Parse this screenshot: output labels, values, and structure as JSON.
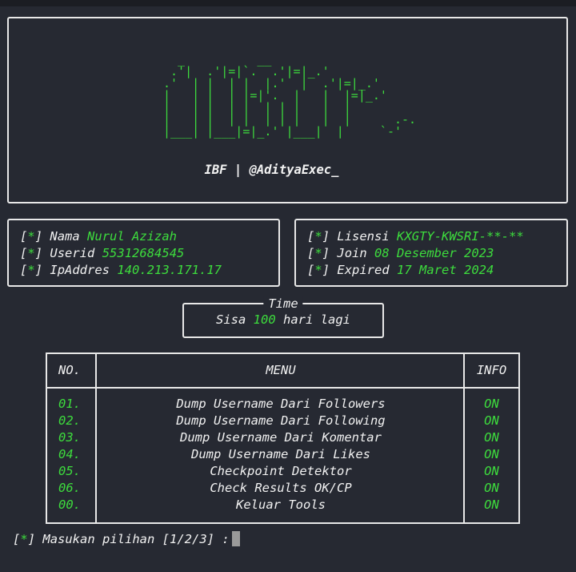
{
  "banner": {
    "ascii_art": "  _          __\n .'|  .'|=|`.  .'|=|_.'\n.'  | |  | |  |.'  |  .'|=|_.'\n|   | |  | |=|'.  |   |  |=|_.'\n|   | |  | |  | | |   |  |\n|   | |  | |  | | |   |  |      .-.\n|___| |___|=|_.' |___|  |     `-'",
    "author": "IBF | @AdityaExec_"
  },
  "user": {
    "marker": "*",
    "rows": [
      {
        "label": "Nama",
        "value": "Nurul Azizah"
      },
      {
        "label": "Userid",
        "value": "55312684545"
      },
      {
        "label": "IpAddres",
        "value": "140.213.171.17"
      }
    ]
  },
  "license": {
    "marker": "*",
    "rows": [
      {
        "label": "Lisensi",
        "value": "KXGTY-KWSRI-**-**"
      },
      {
        "label": "Join",
        "value": "08 Desember 2023"
      },
      {
        "label": "Expired",
        "value": "17 Maret 2024"
      }
    ]
  },
  "time": {
    "title": "Time",
    "prefix": "Sisa",
    "days": "100",
    "suffix": "hari lagi"
  },
  "menu": {
    "headers": {
      "no": "NO.",
      "menu": "MENU",
      "info": "INFO"
    },
    "items": [
      {
        "no": "01.",
        "label": "Dump Username Dari Followers",
        "info": "ON"
      },
      {
        "no": "02.",
        "label": "Dump Username Dari Following",
        "info": "ON"
      },
      {
        "no": "03.",
        "label": "Dump Username Dari Komentar",
        "info": "ON"
      },
      {
        "no": "04.",
        "label": "Dump Username Dari Likes",
        "info": "ON"
      },
      {
        "no": "05.",
        "label": "Checkpoint Detektor",
        "info": "ON"
      },
      {
        "no": "06.",
        "label": "Check Results OK/CP",
        "info": "ON"
      },
      {
        "no": "00.",
        "label": "Keluar Tools",
        "info": "ON"
      }
    ]
  },
  "prompt": {
    "marker": "*",
    "text": "Masukan pilihan [1/2/3] :"
  },
  "colors": {
    "background": "#262932",
    "accent": "#3ddc3d",
    "text": "#f0f0f0",
    "border": "#e8e8e8"
  }
}
